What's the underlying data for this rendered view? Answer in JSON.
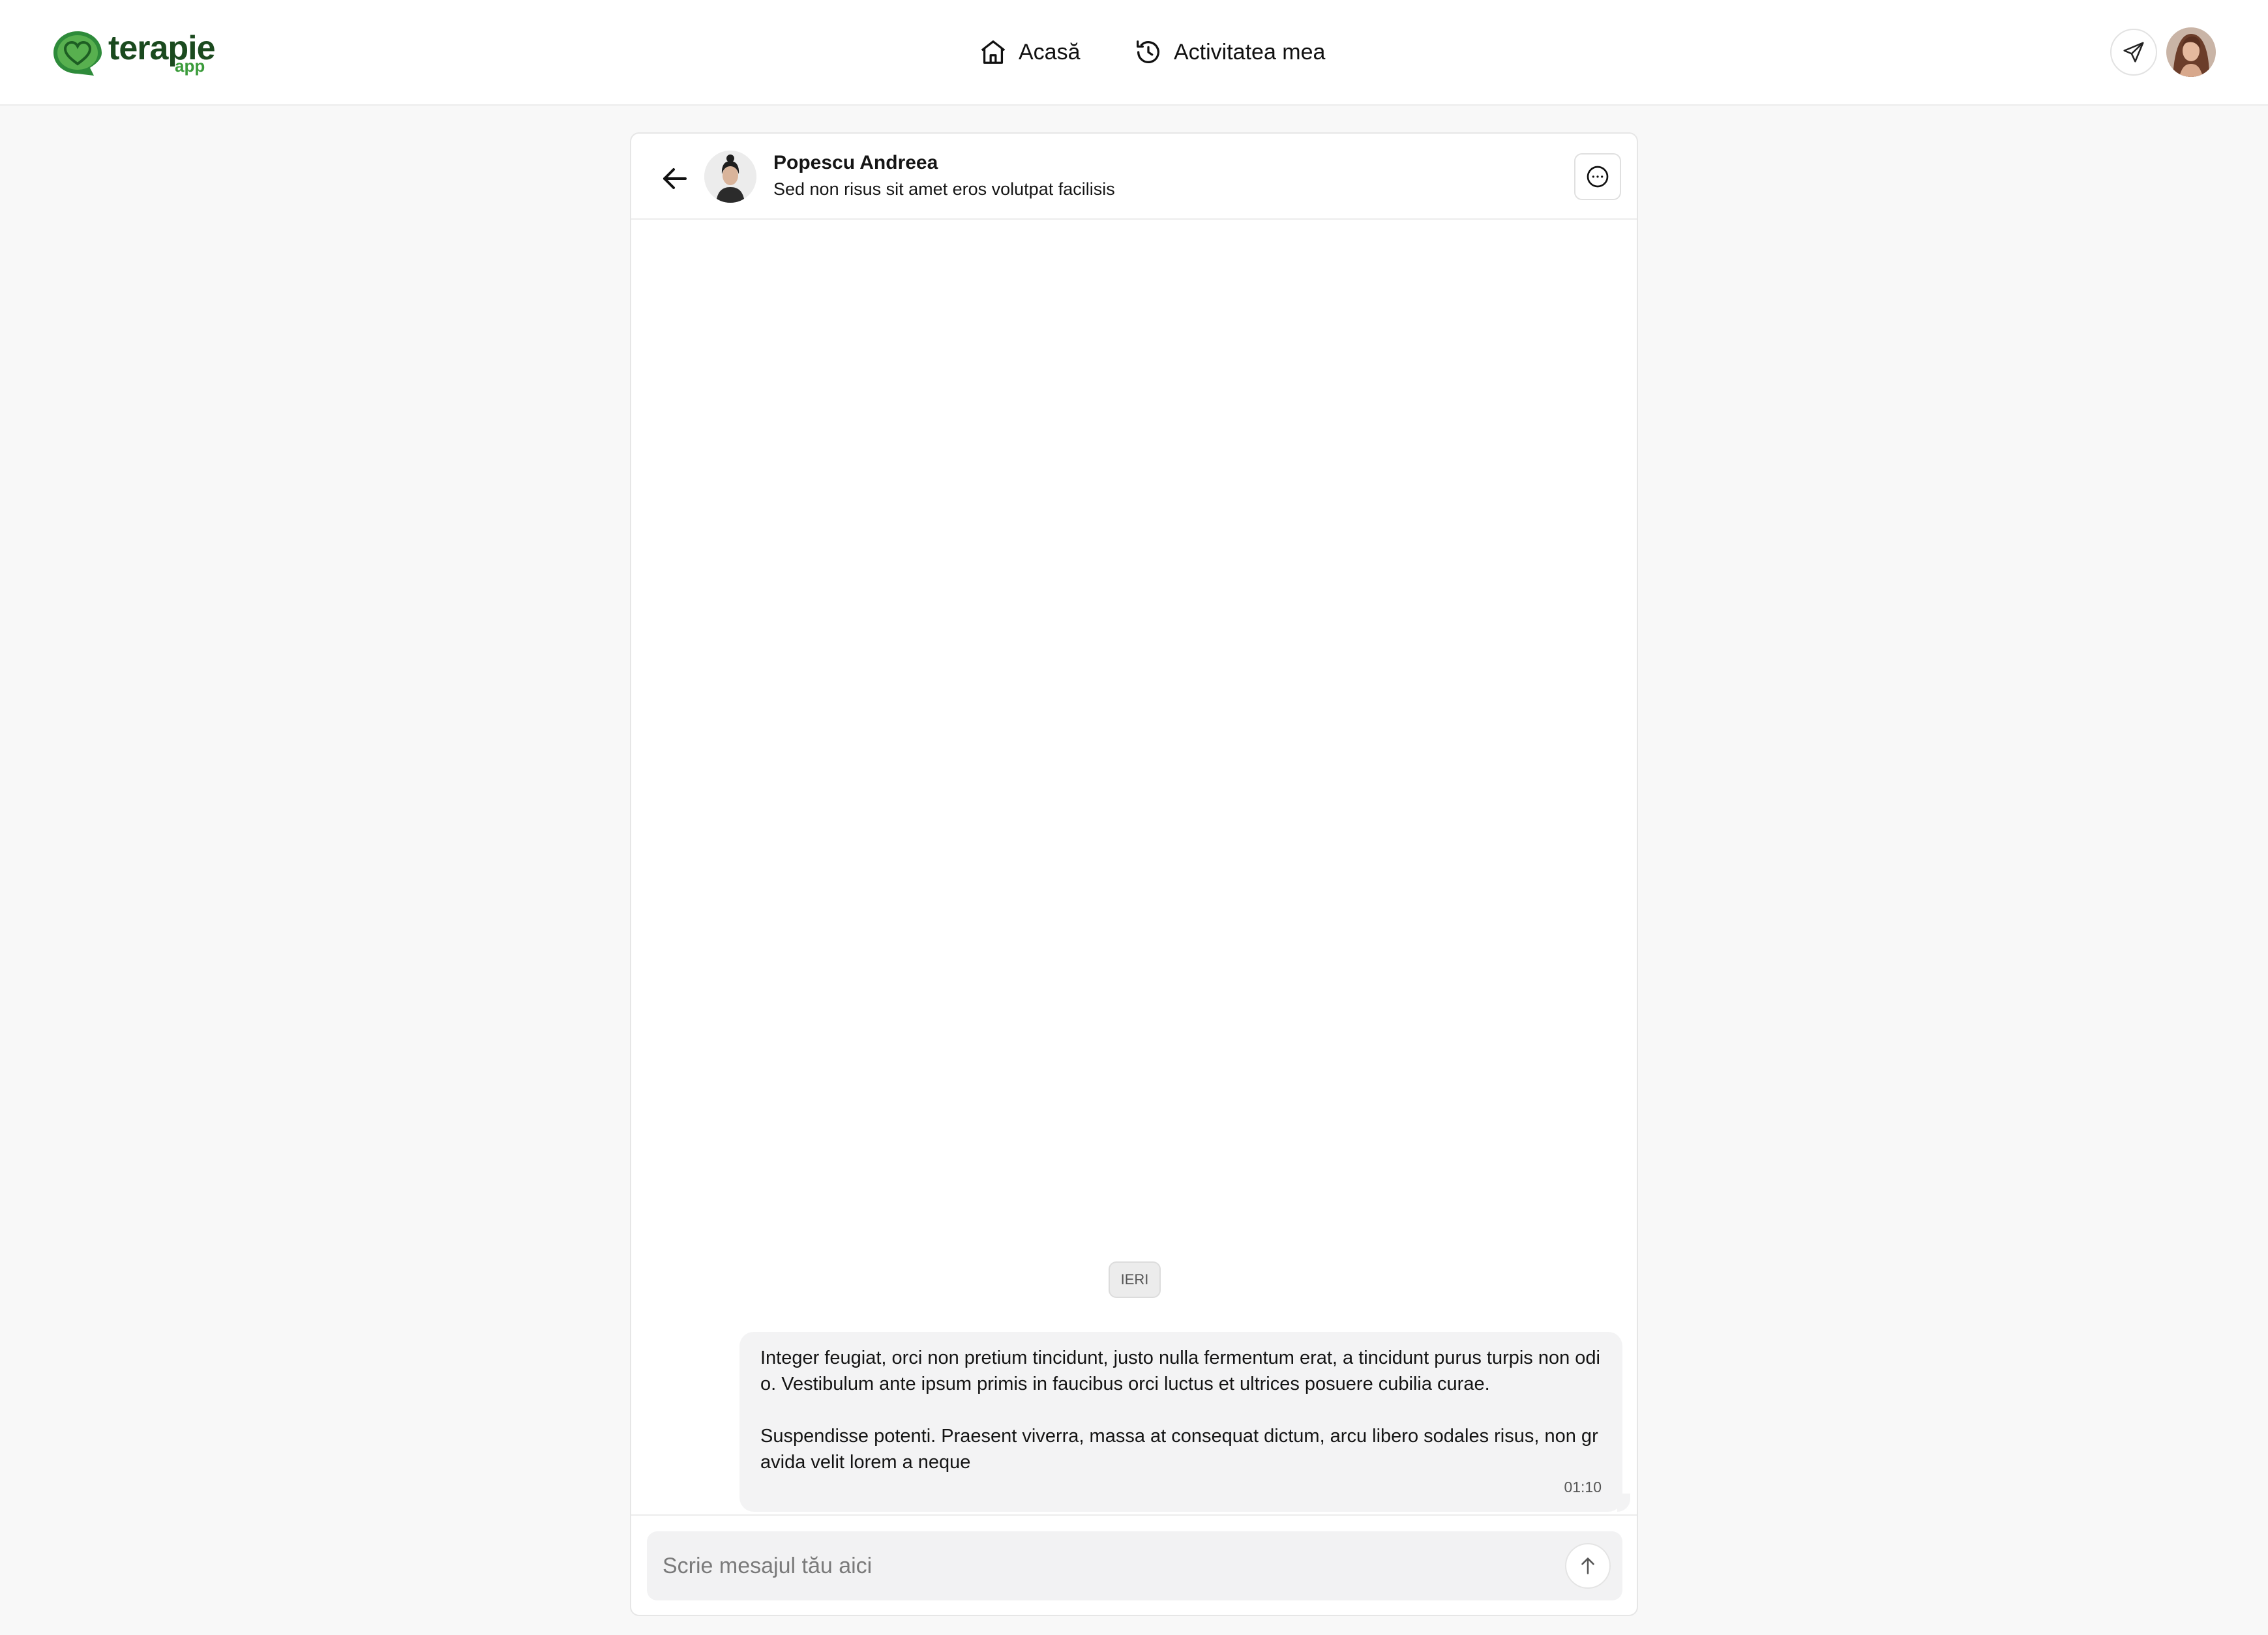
{
  "brand": {
    "name": "terapie",
    "sub": "app",
    "color": "#2e7d32"
  },
  "nav": {
    "home": {
      "label": "Acasă",
      "icon": "home-icon"
    },
    "activity": {
      "label": "Activitatea mea",
      "icon": "history-icon"
    }
  },
  "topbar": {
    "send_icon": "send-icon",
    "user_avatar": "user-avatar"
  },
  "chat": {
    "contact": {
      "name": "Popescu Andreea",
      "subtitle": "Sed non risus sit amet eros volutpat facilisis"
    },
    "date_separator": "IERI",
    "messages": [
      {
        "paragraphs": [
          "Integer feugiat, orci non pretium tincidunt, justo nulla fermentum erat, a tincidunt purus turpis non odio. Vestibulum ante ipsum primis in faucibus orci luctus et ultrices posuere cubilia curae.",
          "Suspendisse potenti. Praesent viverra, massa at consequat dictum, arcu libero sodales risus, non gravida velit lorem a neque"
        ],
        "time": "01:10"
      }
    ],
    "composer": {
      "placeholder": "Scrie mesajul tău aici"
    }
  }
}
